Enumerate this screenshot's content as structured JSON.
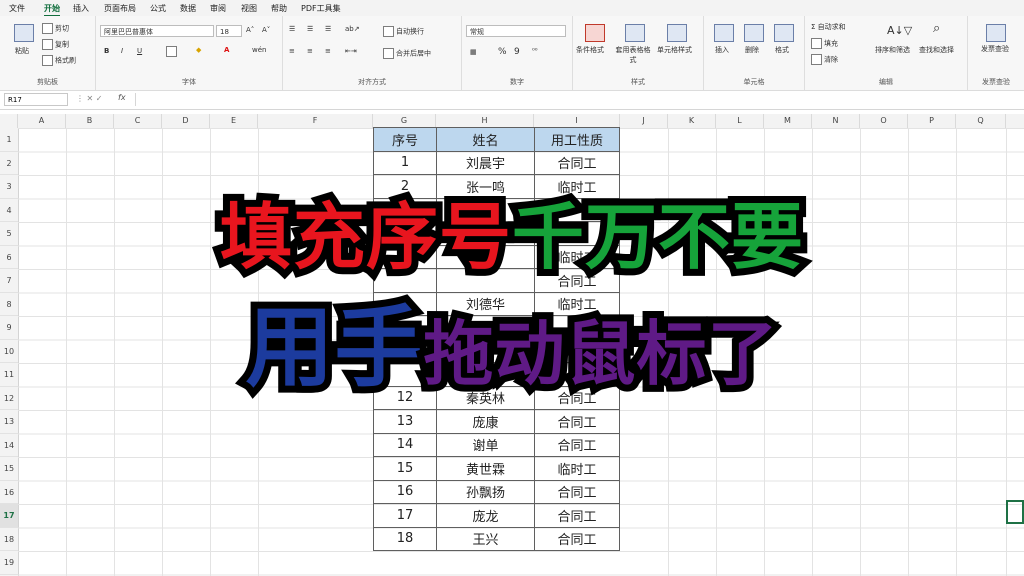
{
  "menu": [
    "文件",
    "开始",
    "插入",
    "页面布局",
    "公式",
    "数据",
    "审阅",
    "视图",
    "帮助",
    "PDF工具集"
  ],
  "ribbon": {
    "clipboard": {
      "paste": "粘贴",
      "cut": "剪切",
      "copy": "复制",
      "format_painter": "格式刷",
      "label": "剪贴板"
    },
    "font": {
      "name": "阿里巴巴普惠体",
      "size": "18",
      "label": "字体",
      "bold": "B",
      "italic": "I",
      "underline": "U",
      "color_a": "A"
    },
    "align": {
      "wrap": "自动换行",
      "merge": "合并后居中",
      "label": "对齐方式"
    },
    "number": {
      "format": "常规",
      "percent": "%",
      "comma": "9",
      "label": "数字"
    },
    "styles": {
      "conditional": "条件格式",
      "table": "套用表格格式",
      "cell_style": "单元格样式",
      "label": "样式"
    },
    "cells": {
      "insert": "插入",
      "delete": "删除",
      "format": "格式",
      "label": "单元格"
    },
    "editing": {
      "autosum": "自动求和",
      "fill": "填充",
      "clear": "清除",
      "sort": "排序和筛选",
      "find": "查找和选择",
      "label": "编辑"
    },
    "invoice": {
      "check": "发票查验",
      "label": "发票查验"
    }
  },
  "formula_bar": {
    "name_box": "R17",
    "fx": "fx",
    "value": ""
  },
  "columns": [
    "A",
    "B",
    "C",
    "D",
    "E",
    "F",
    "G",
    "H",
    "I",
    "J",
    "K",
    "L",
    "M",
    "N",
    "O",
    "P",
    "Q"
  ],
  "rows": [
    "1",
    "2",
    "3",
    "4",
    "5",
    "6",
    "7",
    "8",
    "9",
    "10",
    "11",
    "12",
    "13",
    "14",
    "15",
    "16",
    "17",
    "18",
    "19"
  ],
  "table": {
    "headers": [
      "序号",
      "姓名",
      "用工性质"
    ],
    "rows": [
      [
        "1",
        "刘晨宇",
        "合同工"
      ],
      [
        "2",
        "张一鸣",
        "临时工"
      ],
      [
        "",
        "",
        ""
      ],
      [
        "",
        "",
        ""
      ],
      [
        "",
        "",
        "临时工"
      ],
      [
        "",
        "",
        "合同工"
      ],
      [
        "",
        "刘德华",
        "临时工"
      ],
      [
        "",
        "",
        ""
      ],
      [
        "",
        "",
        ""
      ],
      [
        "",
        "",
        ""
      ],
      [
        "12",
        "秦英林",
        "合同工"
      ],
      [
        "13",
        "庞康",
        "合同工"
      ],
      [
        "14",
        "谢单",
        "合同工"
      ],
      [
        "15",
        "黄世霖",
        "临时工"
      ],
      [
        "16",
        "孙飘扬",
        "合同工"
      ],
      [
        "17",
        "庞龙",
        "合同工"
      ],
      [
        "18",
        "王兴",
        "合同工"
      ]
    ]
  },
  "overlay": {
    "line1_red": "填充序号",
    "line1_green": "千万不要",
    "line2_blue": "用手",
    "line2_purple": "拖动鼠标了"
  },
  "colors": {
    "accent": "#116e3d",
    "header_fill": "#bdd7ee",
    "red": "#e8151e",
    "green": "#16a33a",
    "blue": "#1c3b9e",
    "purple": "#5f1a86"
  }
}
